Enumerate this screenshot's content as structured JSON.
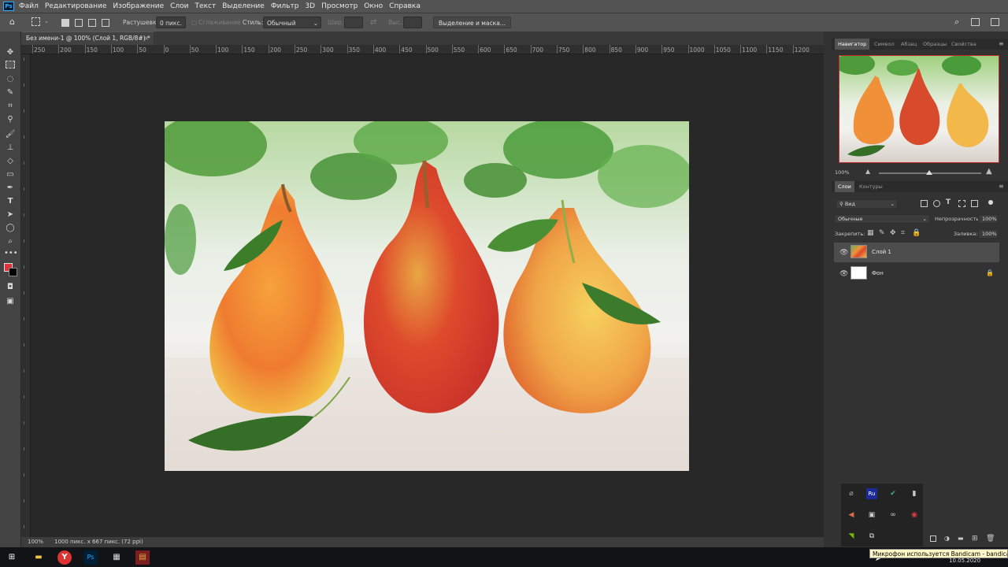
{
  "menu": [
    "Файл",
    "Редактирование",
    "Изображение",
    "Слои",
    "Текст",
    "Выделение",
    "Фильтр",
    "3D",
    "Просмотр",
    "Окно",
    "Справка"
  ],
  "options": {
    "feather_label": "Растушевка:",
    "feather_value": "0 пикс.",
    "antialias_label": "Сглаживание",
    "style_label": "Стиль:",
    "style_value": "Обычный",
    "width_label": "Шир.:",
    "height_label": "Выс.:",
    "select_mask_button": "Выделение и маска..."
  },
  "document": {
    "tab_title": "Без имени-1 @ 100% (Слой 1, RGB/8#) *",
    "zoom": "100%",
    "info": "1000 пикс. x 667 пикс. (72 ppi)"
  },
  "ruler": {
    "h_ticks": [
      "250",
      "200",
      "150",
      "100",
      "50",
      "0",
      "50",
      "100",
      "150",
      "200",
      "250",
      "300",
      "350",
      "400",
      "450",
      "500",
      "550",
      "600",
      "650",
      "700",
      "750",
      "800",
      "850",
      "900",
      "950",
      "1000",
      "1050",
      "1100",
      "1150",
      "1200"
    ]
  },
  "panels": {
    "nav_tabs": [
      "Навигатор",
      "Символ",
      "Абзац",
      "Образцы",
      "Свойства"
    ],
    "nav_zoom": "100%",
    "layer_tabs": [
      "Слои",
      "Контуры"
    ],
    "filter_kind": "Вид",
    "blend_mode": "Обычные",
    "opacity_label": "Непрозрачность:",
    "opacity_value": "100%",
    "lock_label": "Закрепить:",
    "fill_label": "Заливка:",
    "fill_value": "100%",
    "layers": [
      {
        "name": "Слой 1"
      },
      {
        "name": "Фон"
      }
    ]
  },
  "tray": {
    "tooltip": "Микрофон используется Bandicam - bandicam.exe",
    "date": "10.05.2020"
  },
  "colors": {
    "foreground": "#e0303a",
    "background": "#000000"
  }
}
